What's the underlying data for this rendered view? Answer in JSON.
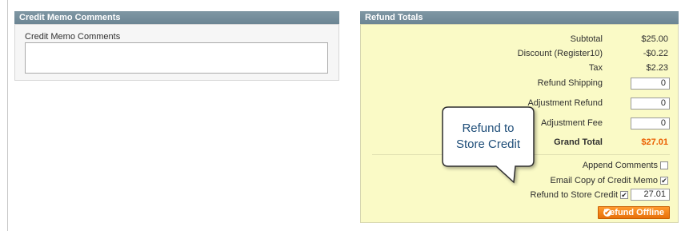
{
  "credit_memo": {
    "header": "Credit Memo Comments",
    "label": "Credit Memo Comments",
    "value": ""
  },
  "refund_totals": {
    "header": "Refund Totals",
    "subtotal_label": "Subtotal",
    "subtotal_value": "$25.00",
    "discount_label": "Discount (Register10)",
    "discount_value": "-$0.22",
    "tax_label": "Tax",
    "tax_value": "$2.23",
    "refund_shipping_label": "Refund Shipping",
    "refund_shipping_value": "0",
    "adjustment_refund_label": "Adjustment Refund",
    "adjustment_refund_value": "0",
    "adjustment_fee_label": "Adjustment Fee",
    "adjustment_fee_value": "0",
    "grand_total_label": "Grand Total",
    "grand_total_value": "$27.01",
    "append_comments_label": "Append Comments",
    "append_comments_checked": false,
    "email_copy_label": "Email Copy of Credit Memo",
    "email_copy_checked": true,
    "store_credit_label": "Refund to Store Credit",
    "store_credit_checked": true,
    "store_credit_value": "27.01",
    "refund_button_label": "Refund Offline"
  },
  "callout": {
    "line1": "Refund to",
    "line2": "Store Credit"
  },
  "colors": {
    "header_bg": "#718b99",
    "totals_bg": "#fafac6",
    "grand_total": "#eb5e00",
    "button": "#f18200"
  },
  "icons": [
    "check-icon",
    "checkbox-checked-icon"
  ]
}
